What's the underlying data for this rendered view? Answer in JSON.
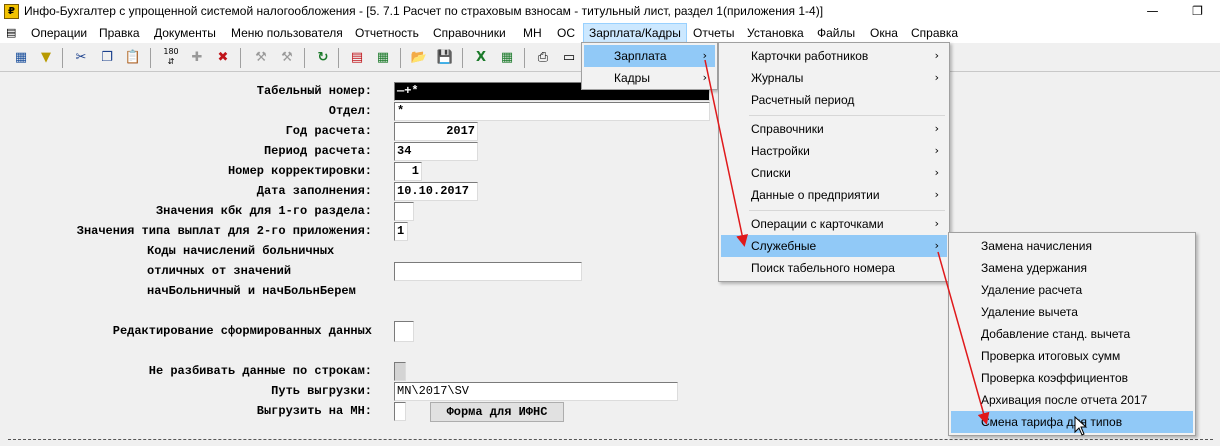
{
  "window": {
    "title": "Инфо-Бухгалтер с упрощенной системой налогообложения - [5.  7.1 Расчет по страховым взносам - титульный лист, раздел 1(приложения 1-4)]",
    "minimize": "—",
    "restore": "❐"
  },
  "menubar": {
    "items": [
      "Операции",
      "Правка",
      "Документы",
      "Меню пользователя",
      "Отчетность",
      "Справочники",
      "МН",
      "ОС",
      "Зарплата/Кадры",
      "Отчеты",
      "Установка",
      "Файлы",
      "Окна",
      "Справка"
    ],
    "active": "Зарплата/Кадры"
  },
  "toolbar": {
    "icons": [
      "grid-icon",
      "filter-icon",
      "scissors-icon",
      "copy-icon",
      "paste-icon",
      "sort-icon",
      "add-icon",
      "delete-icon",
      "tool-icon",
      "tool2-icon",
      "refresh-icon",
      "calendar-icon",
      "calculator-icon",
      "open-folder-icon",
      "save-icon",
      "excel-icon",
      "excel2-icon",
      "print-icon",
      "preview-icon"
    ]
  },
  "form": {
    "tab_number_label": "Табельный номер:",
    "tab_number_value": "—+*",
    "dept_label": "Отдел:",
    "dept_value": "*",
    "year_label": "Год расчета:",
    "year_value": "2017",
    "period_label": "Период расчета:",
    "period_value": "34",
    "correction_label": "Номер корректировки:",
    "correction_value": "1",
    "fill_date_label": "Дата заполнения:",
    "fill_date_value": "10.10.2017",
    "kbk_label": "Значения кбк для 1-го раздела:",
    "kbk_value": "",
    "pay_type_label": "Значения типа выплат для 2-го приложения:",
    "pay_type_value": "1",
    "sick_line1": "Коды начислений больничных",
    "sick_line2": "отличных от значений",
    "sick_line3": "начБольничный и начБольнБерем",
    "sick_value": "",
    "edit_label": "Редактирование сформированных данных",
    "edit_value": "",
    "nosplit_label": "Не разбивать данные по строкам:",
    "nosplit_value": "",
    "path_label": "Путь выгрузки:",
    "path_value": "MN\\2017\\SV",
    "export_mn_label": "Выгрузить на МН:",
    "export_mn_value": "",
    "ifns_button": "Форма для ИФНС"
  },
  "menu_salary_hr": {
    "items": [
      {
        "label": "Зарплата",
        "arrow": "›"
      },
      {
        "label": "Кадры",
        "arrow": "›"
      }
    ]
  },
  "menu_salary": {
    "items": [
      {
        "label": "Карточки работников",
        "arrow": "›"
      },
      {
        "label": "Журналы",
        "arrow": "›"
      },
      {
        "label": "Расчетный период",
        "arrow": ""
      },
      {
        "label": "Справочники",
        "arrow": "›"
      },
      {
        "label": "Настройки",
        "arrow": "›"
      },
      {
        "label": "Списки",
        "arrow": "›"
      },
      {
        "label": "Данные о предприятии",
        "arrow": "›"
      },
      {
        "label": "Операции с карточками",
        "arrow": "›"
      },
      {
        "label": "Служебные",
        "arrow": "›"
      },
      {
        "label": "Поиск табельного номера",
        "arrow": ""
      }
    ]
  },
  "menu_service": {
    "items": [
      "Замена начисления",
      "Замена удержания",
      "Удаление расчета",
      "Удаление вычета",
      "Добавление станд. вычета",
      "Проверка итоговых сумм",
      "Проверка коэффициентов",
      "Архивация после отчета 2017",
      "Смена тарифа для типов"
    ]
  },
  "colors": {
    "highlight": "#91c9f7",
    "menubar_active": "#cce8ff",
    "annotation_arrow": "#e0191b"
  }
}
